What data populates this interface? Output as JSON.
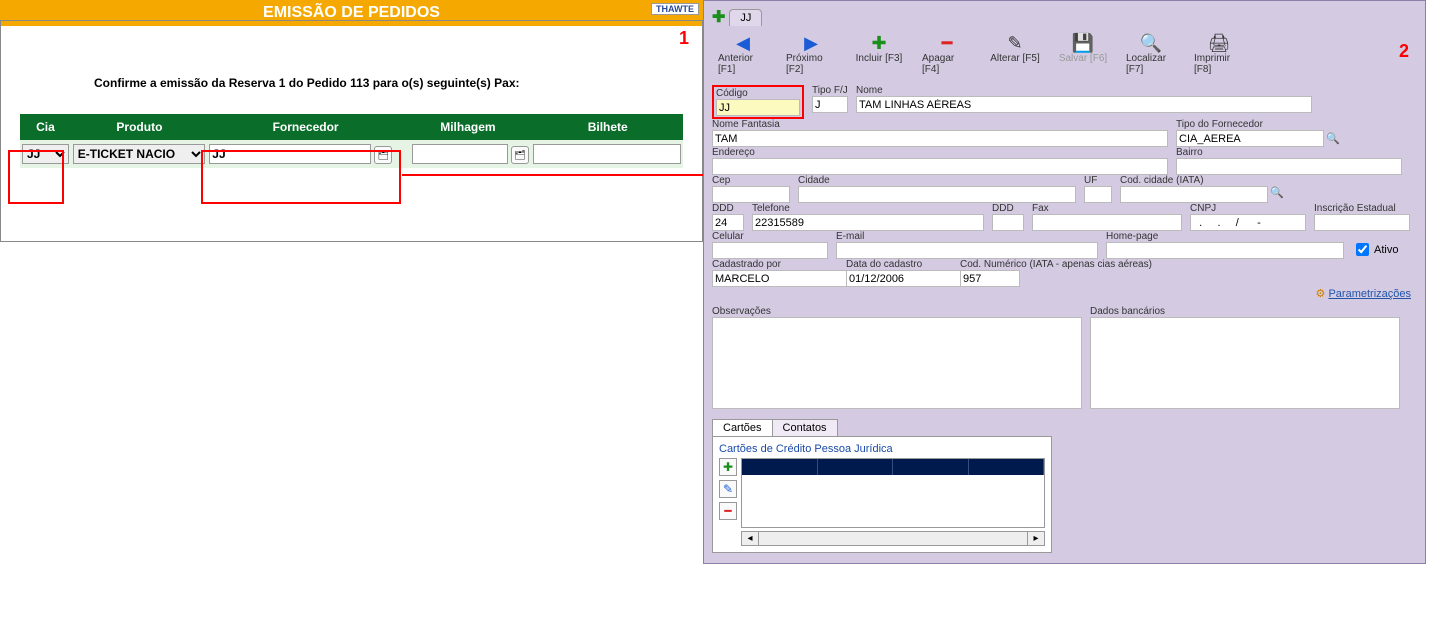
{
  "left": {
    "title": "EMISSÃO DE PEDIDOS",
    "badge": "THAWTE",
    "marker": "1",
    "confirm_text": "Confirme a emissão da Reserva 1 do Pedido 113 para o(s) seguinte(s) Pax:",
    "headers": {
      "cia": "Cia",
      "produto": "Produto",
      "fornecedor": "Fornecedor",
      "milhagem": "Milhagem",
      "bilhete": "Bilhete"
    },
    "row": {
      "cia": "JJ",
      "produto": "E-TICKET NACIO",
      "fornecedor": "JJ",
      "milhagem": "",
      "bilhete": ""
    }
  },
  "right": {
    "marker": "2",
    "tab": "JJ",
    "toolbar": {
      "anterior": "Anterior [F1]",
      "proximo": "Próximo [F2]",
      "incluir": "Incluir [F3]",
      "apagar": "Apagar [F4]",
      "alterar": "Alterar [F5]",
      "salvar": "Salvar [F6]",
      "localizar": "Localizar [F7]",
      "imprimir": "Imprimir [F8]"
    },
    "labels": {
      "codigo": "Código",
      "tipofj": "Tipo F/J",
      "nome": "Nome",
      "nome_fantasia": "Nome Fantasia",
      "tipo_fornecedor": "Tipo do Fornecedor",
      "endereco": "Endereço",
      "bairro": "Bairro",
      "cep": "Cep",
      "cidade": "Cidade",
      "uf": "UF",
      "cod_cidade": "Cod. cidade (IATA)",
      "ddd": "DDD",
      "telefone": "Telefone",
      "ddd2": "DDD",
      "fax": "Fax",
      "cnpj": "CNPJ",
      "ie": "Inscrição Estadual",
      "celular": "Celular",
      "email": "E-mail",
      "homepage": "Home-page",
      "ativo": "Ativo",
      "cadastrado_por": "Cadastrado por",
      "data_cadastro": "Data do cadastro",
      "cod_numerico": "Cod. Numérico (IATA - apenas cias aéreas)",
      "parametrizacoes": "Parametrizações",
      "observacoes": "Observações",
      "dados_bancarios": "Dados bancários",
      "cartoes": "Cartões",
      "contatos": "Contatos",
      "cc_pj": "Cartões de Crédito Pessoa Jurídica"
    },
    "values": {
      "codigo": "JJ",
      "tipofj": "J",
      "nome": "TAM LINHAS AÉREAS",
      "nome_fantasia": "TAM",
      "tipo_fornecedor": "CIA_AEREA",
      "endereco": "",
      "bairro": "",
      "cep": "",
      "cidade": "",
      "uf": "",
      "cod_cidade": "",
      "ddd": "24",
      "telefone": "22315589",
      "ddd2": "",
      "fax": "",
      "cnpj": "  .     .     /      -",
      "ie": "",
      "celular": "",
      "email": "",
      "homepage": "",
      "ativo": true,
      "cadastrado_por": "MARCELO",
      "data_cadastro": "01/12/2006",
      "cod_numerico": "957",
      "observacoes": "",
      "dados_bancarios": ""
    }
  }
}
